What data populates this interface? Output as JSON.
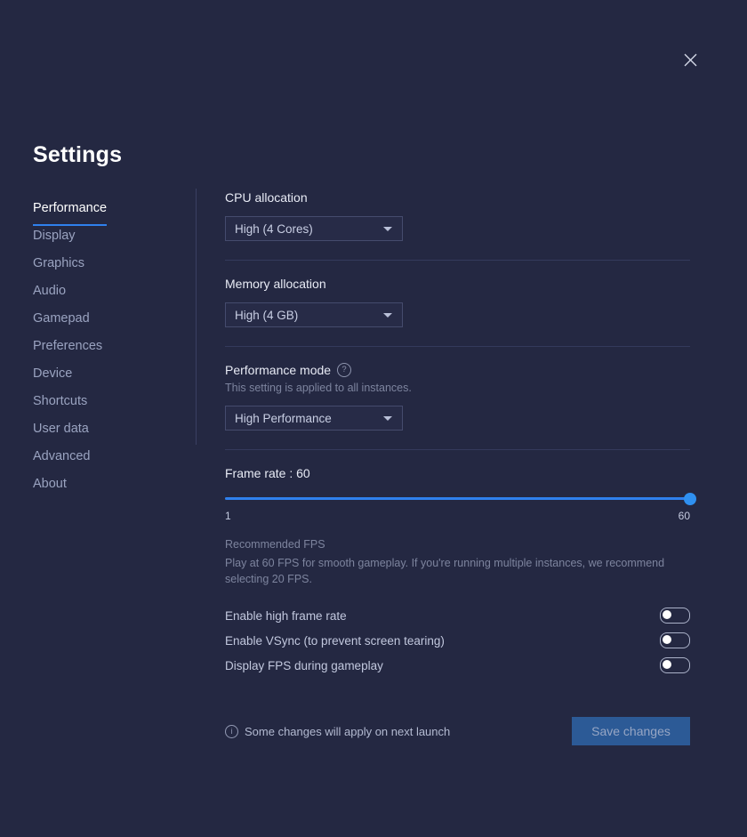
{
  "window": {
    "title": "Settings",
    "close_icon": "close-icon"
  },
  "sidebar": {
    "items": [
      {
        "label": "Performance",
        "active": true
      },
      {
        "label": "Display",
        "active": false
      },
      {
        "label": "Graphics",
        "active": false
      },
      {
        "label": "Audio",
        "active": false
      },
      {
        "label": "Gamepad",
        "active": false
      },
      {
        "label": "Preferences",
        "active": false
      },
      {
        "label": "Device",
        "active": false
      },
      {
        "label": "Shortcuts",
        "active": false
      },
      {
        "label": "User data",
        "active": false
      },
      {
        "label": "Advanced",
        "active": false
      },
      {
        "label": "About",
        "active": false
      }
    ]
  },
  "main": {
    "cpu": {
      "label": "CPU allocation",
      "value": "High (4 Cores)"
    },
    "memory": {
      "label": "Memory allocation",
      "value": "High (4 GB)"
    },
    "performance_mode": {
      "label": "Performance mode",
      "help_icon": "help-circle-icon",
      "help_glyph": "?",
      "sublabel": "This setting is applied to all instances.",
      "value": "High Performance"
    },
    "frame_rate": {
      "label": "Frame rate : 60",
      "value": 60,
      "min": 1,
      "max": 60,
      "min_label": "1",
      "max_label": "60",
      "note_title": "Recommended FPS",
      "note_body": "Play at 60 FPS for smooth gameplay. If you're running multiple instances, we recommend selecting 20 FPS."
    },
    "toggles": [
      {
        "label": "Enable high frame rate",
        "on": false
      },
      {
        "label": "Enable VSync (to prevent screen tearing)",
        "on": false
      },
      {
        "label": "Display FPS during gameplay",
        "on": false
      }
    ]
  },
  "footer": {
    "info_icon": "info-circle-icon",
    "info_glyph": "i",
    "note": "Some changes will apply on next launch",
    "save_label": "Save changes"
  },
  "colors": {
    "background": "#242842",
    "accent": "#2f80ed",
    "slider_thumb": "#2f90f0",
    "save_button": "#2c5a96",
    "divider": "#343a5c"
  }
}
